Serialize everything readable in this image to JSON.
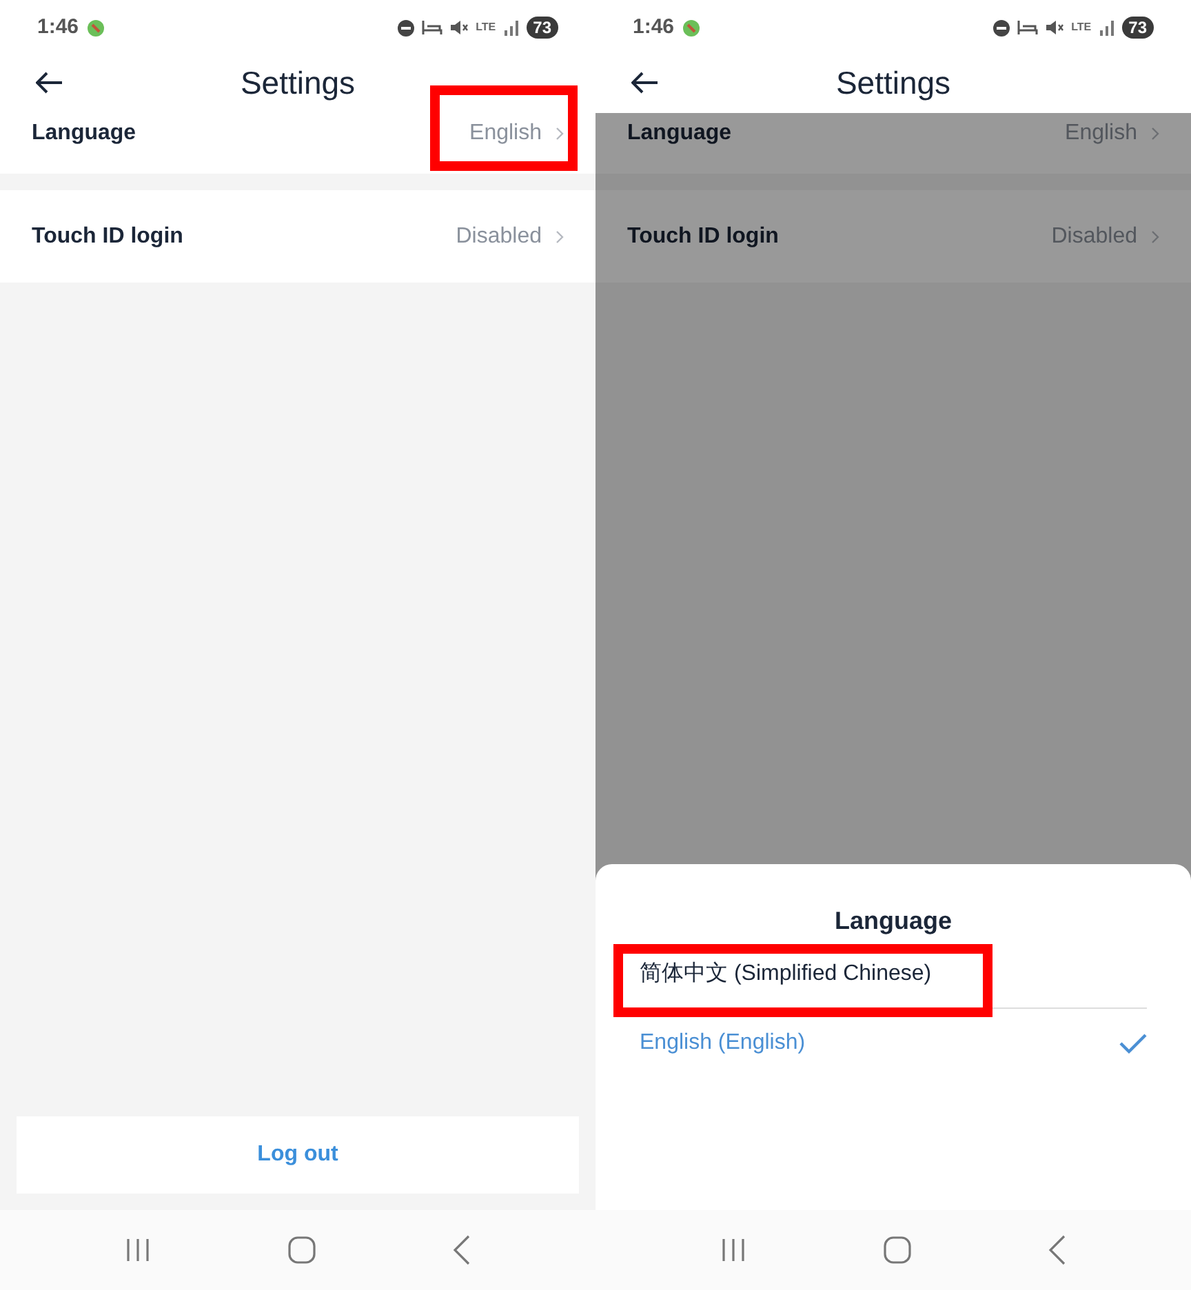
{
  "screens": [
    {
      "status_bar": {
        "time": "1:46",
        "network": "LTE",
        "battery": "73"
      },
      "title": "Settings",
      "dimmed": false,
      "settings": [
        {
          "label": "Language",
          "value": "English",
          "highlighted": true
        },
        {
          "label": "Touch ID login",
          "value": "Disabled",
          "highlighted": false
        }
      ],
      "logout_button": "Log out"
    },
    {
      "status_bar": {
        "time": "1:46",
        "network": "LTE",
        "battery": "73"
      },
      "title": "Settings",
      "dimmed": true,
      "settings": [
        {
          "label": "Language",
          "value": "English",
          "highlighted": false
        },
        {
          "label": "Touch ID login",
          "value": "Disabled",
          "highlighted": false
        }
      ],
      "sheet": {
        "title": "Language",
        "options": [
          {
            "label": "简体中文 (Simplified Chinese)",
            "selected": false,
            "highlighted": true
          },
          {
            "label": "English (English)",
            "selected": true,
            "highlighted": false
          }
        ]
      }
    }
  ]
}
